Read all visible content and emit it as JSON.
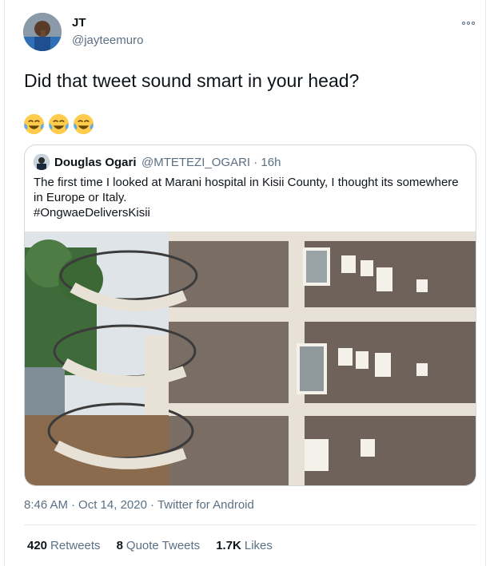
{
  "author": {
    "display_name": "JT",
    "handle": "@jayteemuro"
  },
  "tweet": {
    "text": "Did that tweet sound smart in your head?",
    "emojis": [
      "face-with-tears-of-joy",
      "face-with-tears-of-joy",
      "face-with-tears-of-joy"
    ]
  },
  "quoted_tweet": {
    "display_name": "Douglas Ogari",
    "handle": "@MTETEZI_OGARI",
    "separator": "·",
    "time": "16h",
    "text_line1": "The first time I looked at Marani hospital in Kisii County, I thought its somewhere",
    "text_line2": "in Europe or Italy.",
    "hashtag": "#OngwaeDeliversKisii",
    "photo_description_icon": "building-photo"
  },
  "meta": {
    "time": "8:46 AM",
    "separator": "·",
    "date": "Oct 14, 2020",
    "separator2": "·",
    "source": "Twitter for Android"
  },
  "stats": {
    "retweets_count": "420",
    "retweets_label": "Retweets",
    "quote_count": "8",
    "quote_label": "Quote Tweets",
    "likes_count": "1.7K",
    "likes_label": "Likes"
  },
  "colors": {
    "secondary_text": "#5b7083",
    "border": "#e1e8ed"
  }
}
